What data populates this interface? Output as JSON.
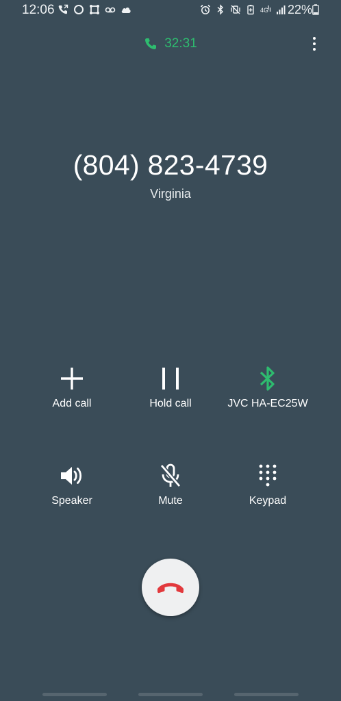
{
  "status_bar": {
    "time": "12:06",
    "battery": "22%",
    "left_icons": [
      "call-forwarding-icon",
      "circle-app-icon",
      "screen-capture-icon",
      "voicemail-icon",
      "cloud-icon"
    ],
    "right_icons": [
      "alarm-icon",
      "bluetooth-icon",
      "vibrate-mute-icon",
      "battery-saver-icon",
      "lte-data-icon",
      "signal-icon"
    ]
  },
  "call": {
    "timer": "32:31",
    "number": "(804) 823-4739",
    "location": "Virginia"
  },
  "controls": {
    "add_call": "Add call",
    "hold_call": "Hold call",
    "bluetooth_device": "JVC HA-EC25W",
    "speaker": "Speaker",
    "mute": "Mute",
    "keypad": "Keypad"
  },
  "colors": {
    "background": "#3a4c58",
    "accent_green": "#2ebc6f",
    "end_call_red": "#e2393d"
  }
}
